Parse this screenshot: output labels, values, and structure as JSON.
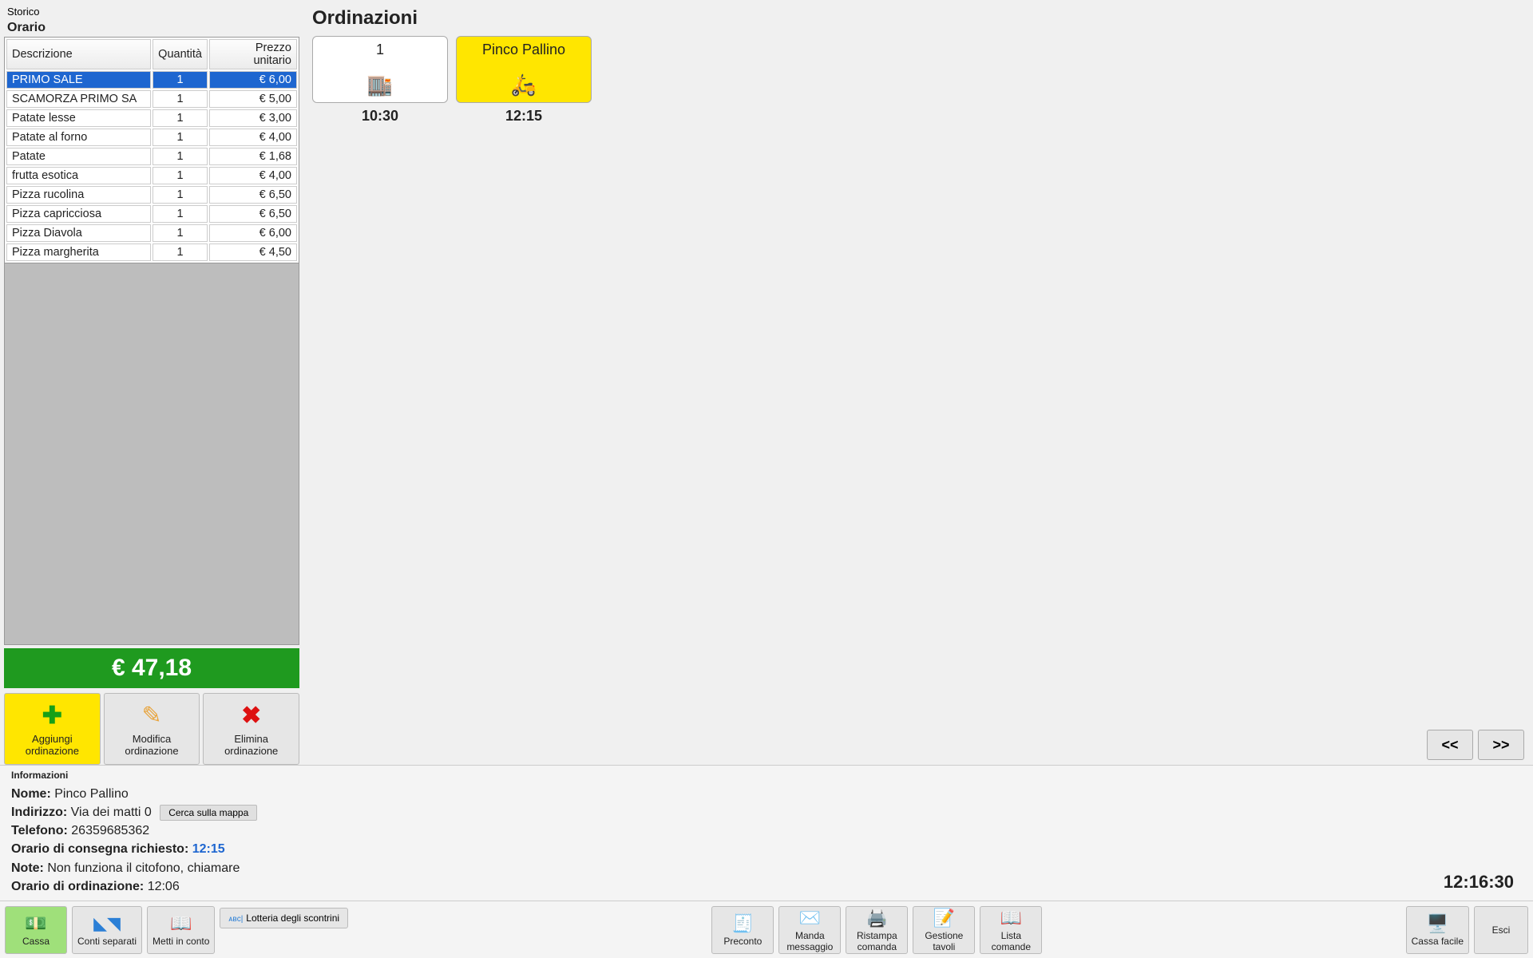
{
  "sidebar": {
    "storico_label": "Storico",
    "orario_label": "Orario",
    "cols": {
      "desc": "Descrizione",
      "qty": "Quantità",
      "price": "Prezzo unitario"
    },
    "rows": [
      {
        "desc": "PRIMO SALE",
        "qty": "1",
        "price": "€ 6,00",
        "selected": true
      },
      {
        "desc": "SCAMORZA PRIMO SA",
        "qty": "1",
        "price": "€ 5,00"
      },
      {
        "desc": "Patate lesse",
        "qty": "1",
        "price": "€ 3,00"
      },
      {
        "desc": "Patate al forno",
        "qty": "1",
        "price": "€ 4,00"
      },
      {
        "desc": "Patate",
        "qty": "1",
        "price": "€ 1,68"
      },
      {
        "desc": "frutta esotica",
        "qty": "1",
        "price": "€ 4,00"
      },
      {
        "desc": "Pizza rucolina",
        "qty": "1",
        "price": "€ 6,50"
      },
      {
        "desc": "Pizza capricciosa",
        "qty": "1",
        "price": "€ 6,50"
      },
      {
        "desc": "Pizza Diavola",
        "qty": "1",
        "price": "€ 6,00"
      },
      {
        "desc": "Pizza margherita",
        "qty": "1",
        "price": "€ 4,50"
      }
    ],
    "total": "€ 47,18",
    "actions": {
      "add": {
        "line1": "Aggiungi",
        "line2": "ordinazione"
      },
      "mod": {
        "line1": "Modifica",
        "line2": "ordinazione"
      },
      "del": {
        "line1": "Elimina",
        "line2": "ordinazione"
      }
    }
  },
  "main": {
    "title": "Ordinazioni",
    "cards": [
      {
        "title": "1",
        "icon": "🏬",
        "time": "10:30",
        "selected": false
      },
      {
        "title": "Pinco Pallino",
        "icon": "🛵",
        "time": "12:15",
        "selected": true
      }
    ],
    "nav": {
      "prev": "<<",
      "next": ">>"
    }
  },
  "info": {
    "header": "Informazioni",
    "name_label": "Nome:",
    "name_value": "Pinco Pallino",
    "addr_label": "Indirizzo:",
    "addr_value": "Via dei matti 0",
    "map_button": "Cerca sulla mappa",
    "phone_label": "Telefono:",
    "phone_value": "26359685362",
    "delivery_label": "Orario di consegna richiesto:",
    "delivery_value": "12:15",
    "note_label": "Note:",
    "note_value": "Non funziona il citofono, chiamare",
    "order_time_label": "Orario di ordinazione:",
    "order_time_value": "12:06",
    "clock": "12:16:30"
  },
  "footer": {
    "cassa": "Cassa",
    "conti_separati": "Conti separati",
    "metti_in_conto": "Metti in conto",
    "lottery": "Lotteria degli scontrini",
    "preconto": "Preconto",
    "manda_msg": {
      "line1": "Manda",
      "line2": "messaggio"
    },
    "ristampa": {
      "line1": "Ristampa",
      "line2": "comanda"
    },
    "gestione": {
      "line1": "Gestione",
      "line2": "tavoli"
    },
    "lista": {
      "line1": "Lista",
      "line2": "comande"
    },
    "cassa_facile": "Cassa facile",
    "esci": "Esci"
  }
}
